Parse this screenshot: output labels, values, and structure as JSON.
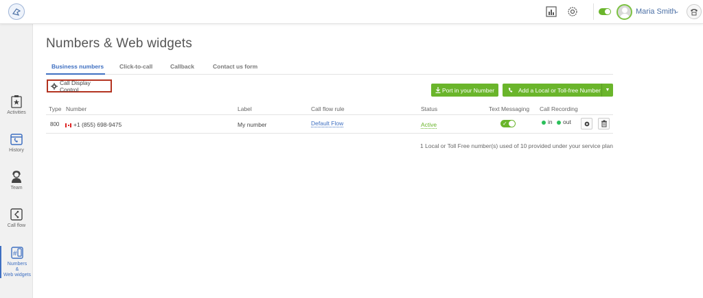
{
  "header": {
    "user_name": "Maria Smith",
    "icons": [
      "logo-icon",
      "reports-icon",
      "settings-icon",
      "status-toggle",
      "avatar",
      "phone-icon"
    ]
  },
  "sidebar": {
    "items": [
      {
        "label": "Activities",
        "icon": "clipboard-star-icon"
      },
      {
        "label": "History",
        "icon": "calendar-phone-icon"
      },
      {
        "label": "Team",
        "icon": "headset-user-icon"
      },
      {
        "label": "Call flow",
        "icon": "call-flow-icon"
      },
      {
        "label_lines": [
          "Numbers",
          "&",
          "Web widgets"
        ],
        "icon": "hash-phone-icon",
        "active": true
      }
    ]
  },
  "page": {
    "title": "Numbers & Web widgets",
    "tabs": [
      "Business numbers",
      "Click-to-call",
      "Callback",
      "Contact us form"
    ],
    "active_tab": "Business numbers",
    "call_display_control": "Call Display Control",
    "port_button": "Port in your Number",
    "add_button": "Add a Local or Toll-free Number"
  },
  "table": {
    "headers": {
      "type": "Type",
      "number": "Number",
      "label": "Label",
      "call_flow_rule": "Call flow rule",
      "status": "Status",
      "text_messaging": "Text Messaging",
      "call_recording": "Call Recording"
    },
    "rows": [
      {
        "type": "800",
        "number": "+1 (855) 698-9475",
        "label": "My number",
        "call_flow_rule": "Default Flow",
        "status": "Active",
        "text_messaging_on": true,
        "rec_in": "in",
        "rec_out": "out"
      }
    ]
  },
  "footer": {
    "usage_text": "1 Local or Toll Free number(s) used of 10 provided under your service plan"
  },
  "colors": {
    "accent_blue": "#3e6fc1",
    "accent_green": "#6ab52b",
    "highlight_red": "#b3321f"
  }
}
